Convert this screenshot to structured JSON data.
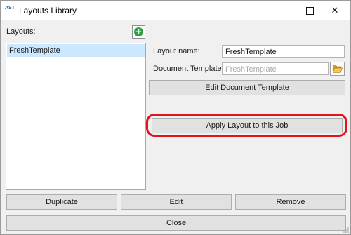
{
  "window": {
    "title": "Layouts Library",
    "app_icon_text": "AST",
    "controls": {
      "minimize": "—",
      "close": "✕"
    }
  },
  "layouts_label": "Layouts:",
  "layouts_list": [
    {
      "label": "FreshTemplate",
      "selected": true
    }
  ],
  "form": {
    "layout_name_label": "Layout name:",
    "layout_name_value": "FreshTemplate",
    "document_template_label": "Document Template:",
    "document_template_value": "FreshTemplate"
  },
  "buttons": {
    "edit_document_template": "Edit Document Template",
    "apply_layout": "Apply Layout to this Job",
    "duplicate": "Duplicate",
    "edit": "Edit",
    "remove": "Remove",
    "close": "Close"
  },
  "colors": {
    "highlight": "#e0141a",
    "selection": "#cce8ff",
    "add_icon": "#2f9e44",
    "folder_icon": "#f0b429"
  },
  "icons": {
    "add": "plus-circle-icon",
    "browse": "folder-open-icon",
    "app": "ast-logo-icon"
  }
}
